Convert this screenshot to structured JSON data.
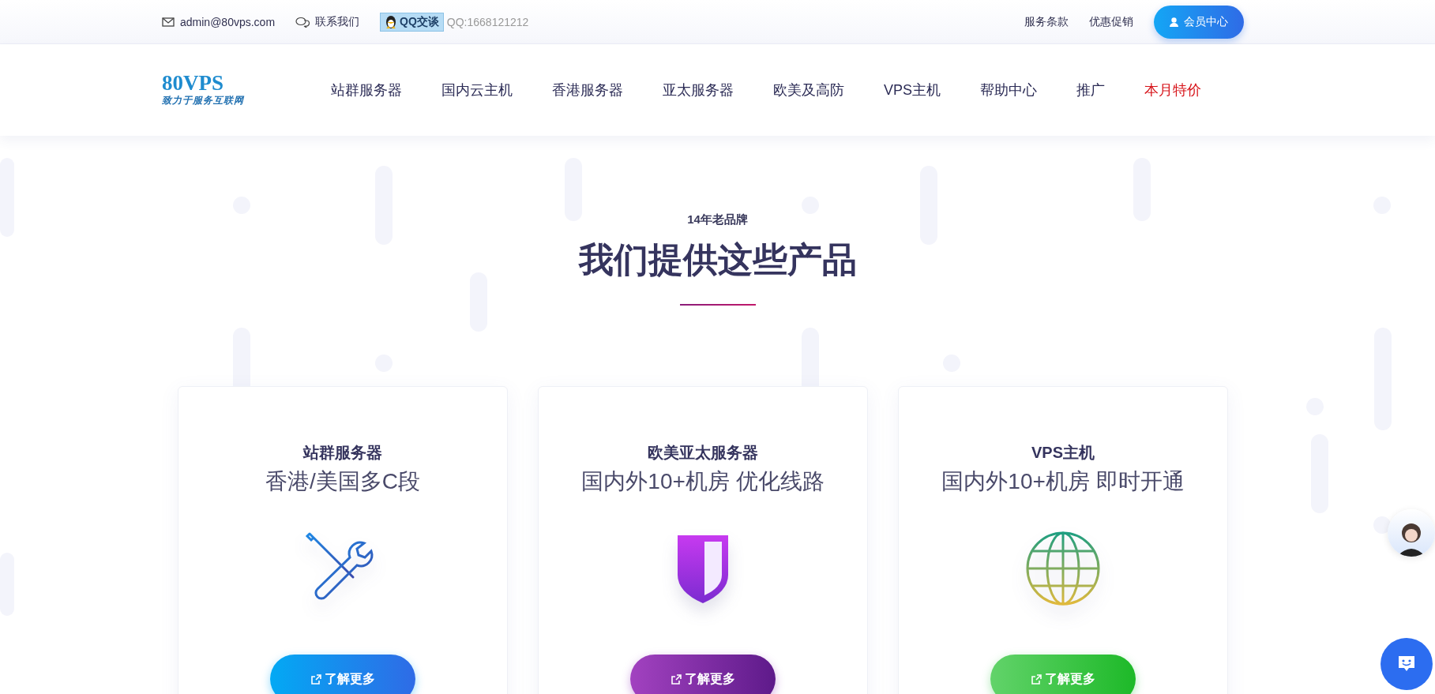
{
  "top_bar": {
    "email": "admin@80vps.com",
    "contact": "联系我们",
    "qq_button": "QQ交谈",
    "qq_number": "QQ:1668121212",
    "links": [
      "服务条款",
      "优惠促销"
    ],
    "member_button": "会员中心"
  },
  "nav": {
    "logo": {
      "name": "80VPS",
      "slogan": "致力于服务互联网"
    },
    "items": [
      {
        "label": "站群服务器",
        "kind": "normal"
      },
      {
        "label": "国内云主机",
        "kind": "normal"
      },
      {
        "label": "香港服务器",
        "kind": "normal"
      },
      {
        "label": "亚太服务器",
        "kind": "normal"
      },
      {
        "label": "欧美及高防",
        "kind": "normal"
      },
      {
        "label": "VPS主机",
        "kind": "normal"
      },
      {
        "label": "帮助中心",
        "kind": "normal"
      },
      {
        "label": "推广",
        "kind": "normal"
      },
      {
        "label": "本月特价",
        "kind": "promo"
      }
    ]
  },
  "section": {
    "eyebrow": "14年老品牌",
    "heading": "我们提供这些产品"
  },
  "cards": [
    {
      "kind": "tools",
      "title": "站群服务器",
      "subtitle": "香港/美国多C段",
      "button": "了解更多"
    },
    {
      "kind": "shield",
      "title": "欧美亚太服务器",
      "subtitle": "国内外10+机房 优化线路",
      "button": "了解更多"
    },
    {
      "kind": "globe",
      "title": "VPS主机",
      "subtitle": "国内外10+机房 即时开通",
      "button": "了解更多"
    }
  ]
}
